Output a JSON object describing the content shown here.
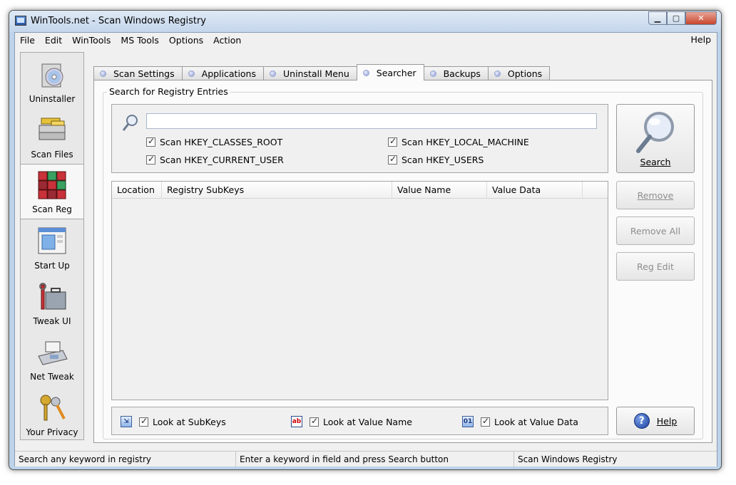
{
  "window": {
    "title": "WinTools.net - Scan Windows Registry"
  },
  "menu": {
    "items": [
      "File",
      "Edit",
      "WinTools",
      "MS Tools",
      "Options",
      "Action"
    ],
    "help": "Help"
  },
  "sidebar": {
    "items": [
      {
        "label": "Uninstaller",
        "icon": "uninstaller-cd-icon"
      },
      {
        "label": "Scan Files",
        "icon": "scan-files-stack-icon"
      },
      {
        "label": "Scan Reg",
        "icon": "scan-reg-cube-icon",
        "active": true
      },
      {
        "label": "Start Up",
        "icon": "start-up-window-icon"
      },
      {
        "label": "Tweak UI",
        "icon": "tweak-ui-toolbox-icon"
      },
      {
        "label": "Net Tweak",
        "icon": "net-tweak-fax-icon"
      },
      {
        "label": "Your Privacy",
        "icon": "your-privacy-keys-icon"
      }
    ]
  },
  "tabs": [
    {
      "label": "Scan Settings"
    },
    {
      "label": "Applications"
    },
    {
      "label": "Uninstall Menu"
    },
    {
      "label": "Searcher",
      "active": true
    },
    {
      "label": "Backups"
    },
    {
      "label": "Options"
    }
  ],
  "searcher": {
    "group_title": "Search for Registry Entries",
    "search_value": "",
    "checks": {
      "classes_root": "Scan HKEY_CLASSES_ROOT",
      "local_machine": "Scan HKEY_LOCAL_MACHINE",
      "current_user": "Scan HKEY_CURRENT_USER",
      "users": "Scan HKEY_USERS"
    },
    "columns": [
      "Location",
      "Registry SubKeys",
      "Value Name",
      "Value Data"
    ],
    "buttons": {
      "search": "Search",
      "remove": "Remove",
      "remove_all": "Remove All",
      "reg_edit": "Reg Edit",
      "help": "Help"
    },
    "look_at": {
      "subkeys": "Look at SubKeys",
      "value_name": "Look at Value Name",
      "value_data": "Look at Value Data"
    }
  },
  "statusbar": {
    "left": "Search any keyword in registry",
    "middle": "Enter a keyword in field and press Search button",
    "right": "Scan Windows Registry"
  },
  "colors": {
    "titlebar": "#c4d6ec",
    "tab_active": "#fbfbfb",
    "disabled_text": "#8d8d8d"
  }
}
